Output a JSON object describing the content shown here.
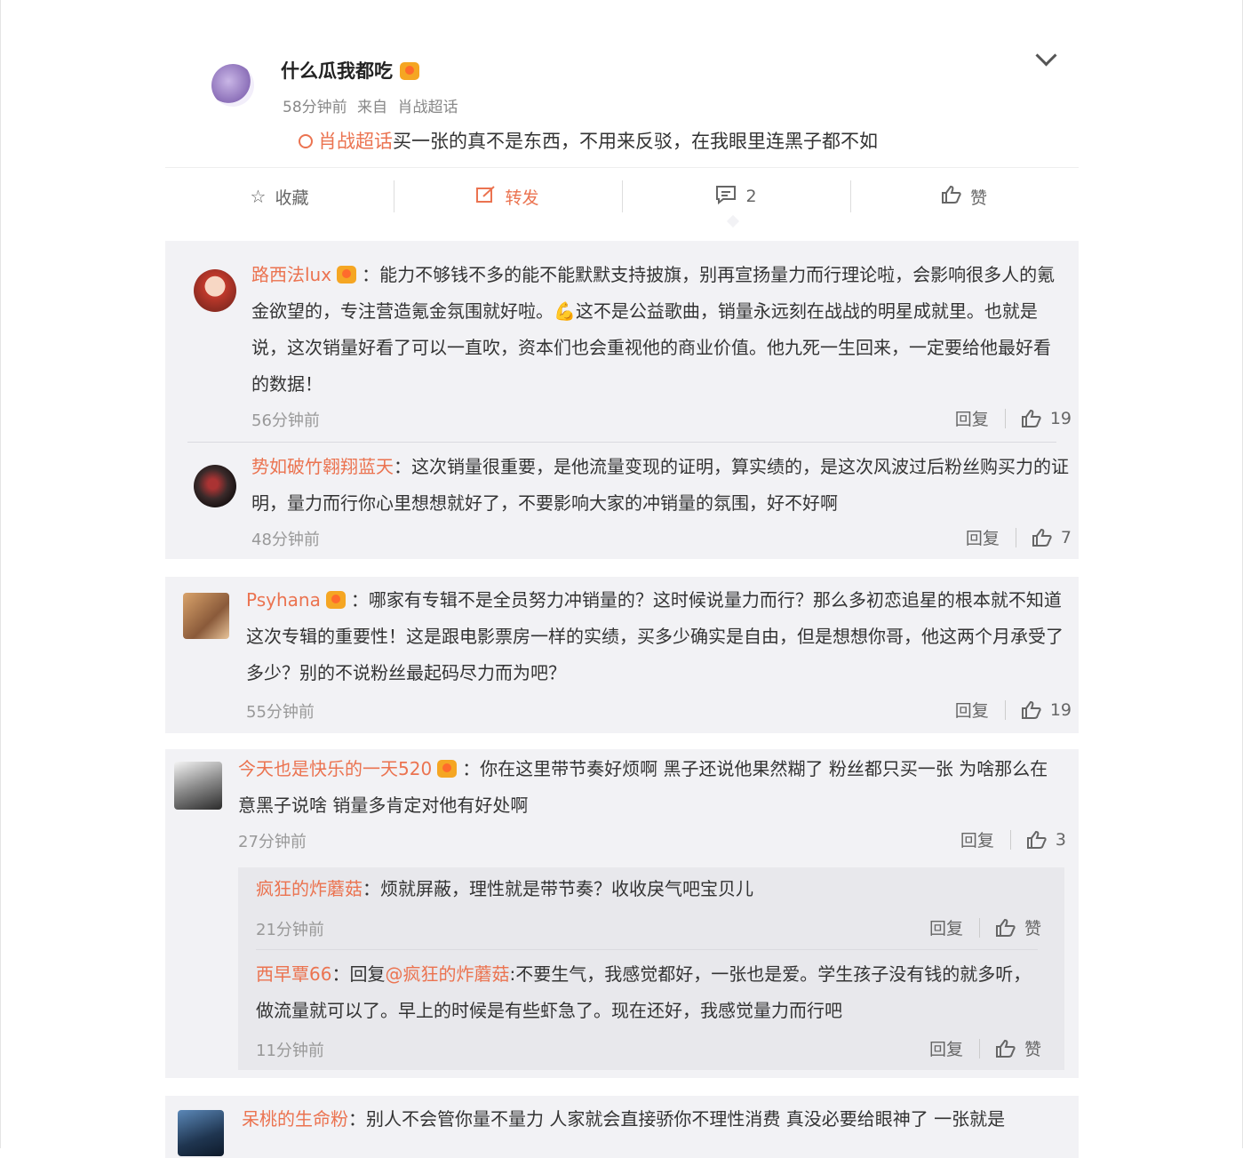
{
  "post": {
    "author": "什么瓜我都吃",
    "time": "58分钟前",
    "from_label": "来自",
    "source": "肖战超话",
    "topic": "肖战超话",
    "text": "买一张的真不是东西，不用来反驳，在我眼里连黑子都不如",
    "actions": {
      "favorite": "收藏",
      "repost": "转发",
      "comment_count": "2",
      "like": "赞"
    }
  },
  "comments": [
    {
      "user": "路西法lux",
      "text": "：能力不够钱不多的能不能默默支持披旗，别再宣扬量力而行理论啦，会影响很多人的氪金欲望的，专注营造氪金氛围就好啦。💪这不是公益歌曲，销量永远刻在战战的明星成就里。也就是说，这次销量好看了可以一直吹，资本们也会重视他的商业价值。他九死一生回来，一定要给他最好看的数据！",
      "time": "56分钟前",
      "reply": "回复",
      "likes": "19"
    },
    {
      "user": "势如破竹翱翔蓝天",
      "text": "：这次销量很重要，是他流量变现的证明，算实绩的，是这次风波过后粉丝购买力的证明，量力而行你心里想想就好了，不要影响大家的冲销量的氛围，好不好啊",
      "time": "48分钟前",
      "reply": "回复",
      "likes": "7"
    },
    {
      "user": "Psyhana",
      "text": "：哪家有专辑不是全员努力冲销量的？这时候说量力而行？那么多初恋追星的根本就不知道这次专辑的重要性！这是跟电影票房一样的实绩，买多少确实是自由，但是想想你哥，他这两个月承受了多少？别的不说粉丝最起码尽力而为吧？",
      "time": "55分钟前",
      "reply": "回复",
      "likes": "19"
    },
    {
      "user": "今天也是快乐的一天520",
      "text": "：你在这里带节奏好烦啊 黑子还说他果然糊了 粉丝都只买一张 为啥那么在意黑子说啥 销量多肯定对他有好处啊",
      "time": "27分钟前",
      "reply": "回复",
      "likes": "3",
      "replies": [
        {
          "user": "疯狂的炸蘑菇",
          "text": "：烦就屏蔽，理性就是带节奏？收收戾气吧宝贝儿",
          "time": "21分钟前",
          "reply": "回复",
          "like": "赞"
        },
        {
          "user": "西早覃66",
          "prefix": "：回复",
          "mention": "@疯狂的炸蘑菇",
          "text": ":不要生气，我感觉都好，一张也是爱。学生孩子没有钱的就多听，做流量就可以了。早上的时候是有些虾急了。现在还好，我感觉量力而行吧",
          "time": "11分钟前",
          "reply": "回复",
          "like": "赞"
        }
      ]
    },
    {
      "user": "呆桃的生命粉",
      "text": "：别人不会管你量不量力 人家就会直接骄你不理性消费 真没必要给眼神了 一张就是"
    }
  ],
  "colors": {
    "accent": "#eb7350",
    "comment_bg": "#f2f2f5",
    "subreply_bg": "#e8e8ec"
  }
}
